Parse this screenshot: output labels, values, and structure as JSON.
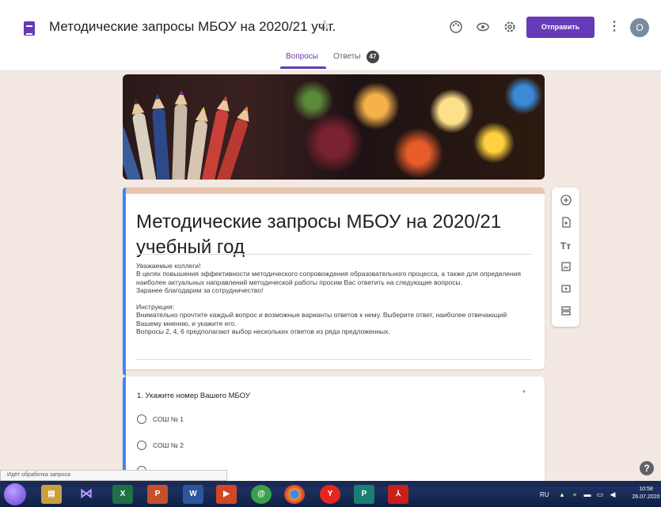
{
  "header": {
    "form_title": "Методические запросы МБОУ на 2020/21 уч.г.",
    "send_label": "Отправить",
    "avatar_letter": "О",
    "tabs": [
      {
        "label": "Вопросы",
        "active": true
      },
      {
        "label": "Ответы",
        "badge": "47",
        "active": false
      }
    ],
    "icons": [
      "palette-icon",
      "eye-icon",
      "settings-icon",
      "star-icon",
      "more-vert-icon"
    ]
  },
  "form": {
    "title": "Методические запросы МБОУ на 2020/21 учебный год",
    "description": "Уважаемые коллеги!\nВ целях повышения эффективности методического сопровождения образовательного процесса, а также для определения наиболее актуальных направлений методической работы просим Вас ответить на следующие вопросы.\nЗаранее благодарим за сотрудничество!\n\nИнструкция:\nВнимательно прочтите каждый вопрос и возможные варианты ответов к нему. Выберите ответ, наиболее отвечающий Вашему мнению, и укажите его.\nВопросы 2, 4, 6 предполагают выбор нескольких ответов из ряда предложенных."
  },
  "question": {
    "title": "1. Укажите номер Вашего МБОУ",
    "required_mark": "*",
    "options": [
      "СОШ № 1",
      "СОШ № 2"
    ]
  },
  "toolbar": [
    "add-question-icon",
    "import-questions-icon",
    "add-title-icon",
    "add-image-icon",
    "add-video-icon",
    "add-section-icon"
  ],
  "status_text": "Идёт обработка запроса",
  "taskbar": {
    "lang": "RU",
    "time": "10:58",
    "date": "26.07.2020"
  },
  "colors": {
    "accent": "#673ab7",
    "background": "#f3e9e2",
    "left_border": "#4285f4"
  }
}
